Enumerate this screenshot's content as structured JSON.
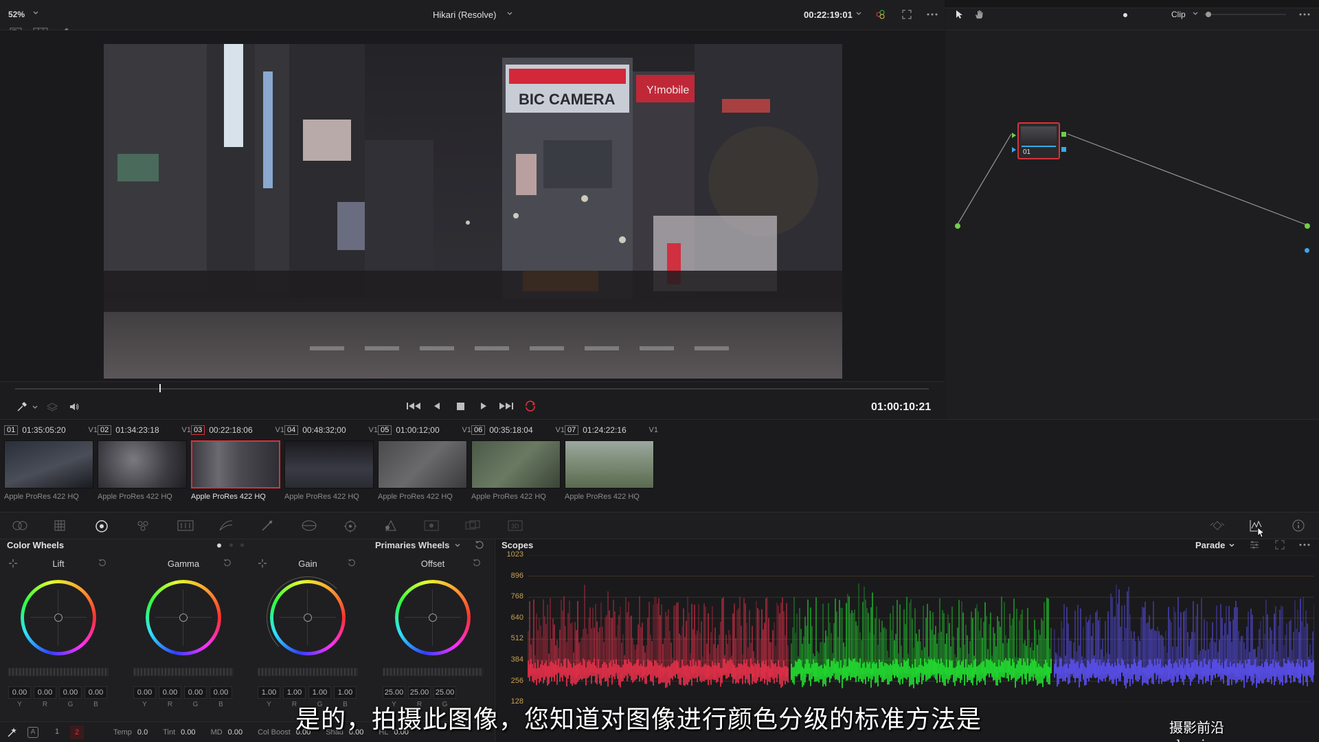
{
  "viewer": {
    "zoom": "52%",
    "project_title": "Hikari (Resolve)",
    "source_timecode": "00:22:19:01",
    "record_timecode": "01:00:10:21"
  },
  "node_editor": {
    "mode": "Clip",
    "node_label": "01"
  },
  "clips": [
    {
      "num": "01",
      "tc": "01:35:05:20",
      "track": "V1",
      "codec": "Apple ProRes 422 HQ",
      "selected": false
    },
    {
      "num": "02",
      "tc": "01:34:23:18",
      "track": "V1",
      "codec": "Apple ProRes 422 HQ",
      "selected": false
    },
    {
      "num": "03",
      "tc": "00:22:18:06",
      "track": "V1",
      "codec": "Apple ProRes 422 HQ",
      "selected": true
    },
    {
      "num": "04",
      "tc": "00:48:32;00",
      "track": "V1",
      "codec": "Apple ProRes 422 HQ",
      "selected": false
    },
    {
      "num": "05",
      "tc": "01:00:12;00",
      "track": "V1",
      "codec": "Apple ProRes 422 HQ",
      "selected": false
    },
    {
      "num": "06",
      "tc": "00:35:18:04",
      "track": "V1",
      "codec": "Apple ProRes 422 HQ",
      "selected": false
    },
    {
      "num": "07",
      "tc": "01:24:22:16",
      "track": "V1",
      "codec": "Apple ProRes 422 HQ",
      "selected": false
    }
  ],
  "color_wheels": {
    "title": "Color Wheels",
    "mode": "Primaries Wheels",
    "wheels": [
      {
        "name": "Lift",
        "values": [
          "0.00",
          "0.00",
          "0.00",
          "0.00"
        ]
      },
      {
        "name": "Gamma",
        "values": [
          "0.00",
          "0.00",
          "0.00",
          "0.00"
        ]
      },
      {
        "name": "Gain",
        "values": [
          "1.00",
          "1.00",
          "1.00",
          "1.00"
        ]
      },
      {
        "name": "Offset",
        "values": [
          "25.00",
          "25.00",
          "25.00"
        ]
      }
    ],
    "channels": [
      "Y",
      "R",
      "G",
      "B"
    ],
    "params": [
      {
        "label": "Temp",
        "value": "0.0"
      },
      {
        "label": "Tint",
        "value": "0.00"
      },
      {
        "label": "MD",
        "value": "0.00"
      },
      {
        "label": "Col Boost",
        "value": "0.00"
      },
      {
        "label": "Shad",
        "value": "0.00"
      },
      {
        "label": "HL",
        "value": "0.00"
      }
    ],
    "pages": [
      "1",
      "2"
    ]
  },
  "scopes": {
    "title": "Scopes",
    "mode": "Parade",
    "scale": [
      "1023",
      "896",
      "768",
      "640",
      "512",
      "384",
      "256",
      "128"
    ]
  },
  "overlay": {
    "subtitle": "是的，拍摄此图像，您知道对图像进行颜色分级的标准方法是",
    "watermark": "摄影前沿 sheyingzyz.com"
  },
  "colors": {
    "selected_clip_border": "#d8323a",
    "parade_red": "#e8304a",
    "parade_green": "#22e030",
    "parade_blue": "#5a50f0",
    "scale_label": "#c8a050"
  }
}
